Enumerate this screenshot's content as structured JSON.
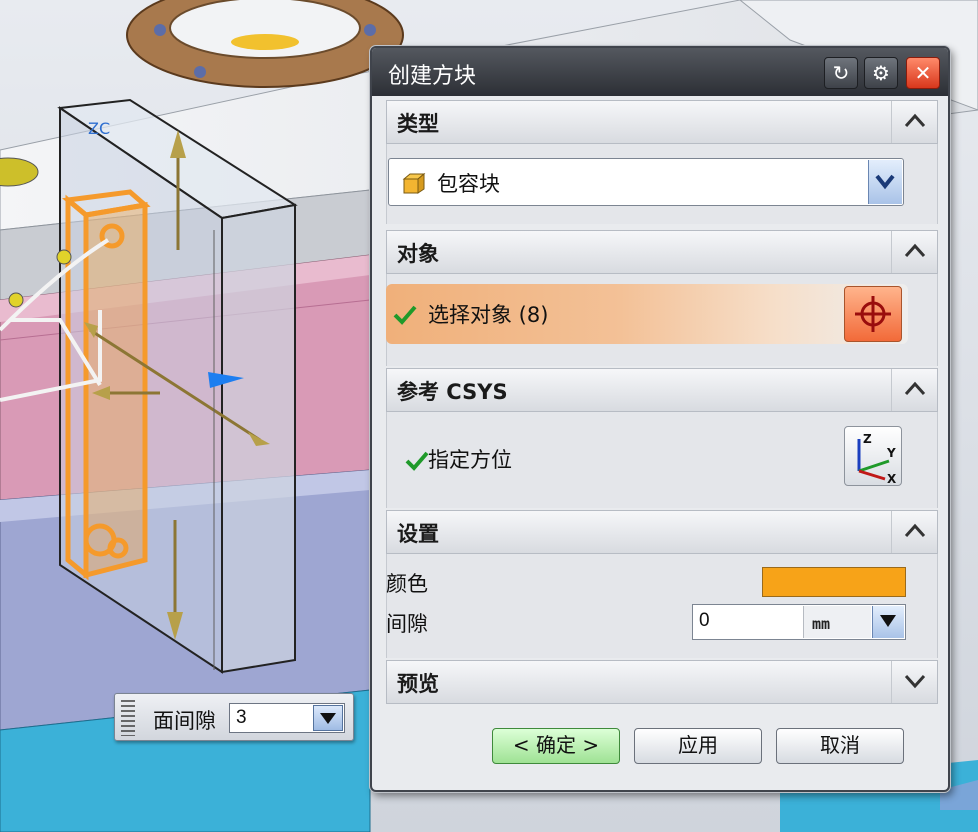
{
  "dialog": {
    "title": "创建方块",
    "buttons": {
      "reset": "↻",
      "settings": "⚙",
      "close": "✕"
    }
  },
  "sections": {
    "type": {
      "title": "类型",
      "selected": "包容块",
      "icon": "bounding-block-icon"
    },
    "object": {
      "title": "对象",
      "select_label": "选择对象 (8)",
      "status_icon": "check-icon",
      "button_icon": "crosshair-icon"
    },
    "csys": {
      "title": "参考 CSYS",
      "orient_label": "指定方位",
      "status_icon": "check-icon",
      "button_icon": "csys-axes-icon"
    },
    "settings": {
      "title": "设置",
      "color_label": "颜色",
      "color_value": "#f7a318",
      "gap_label": "间隙",
      "gap_value": "0",
      "gap_unit": "mm"
    },
    "preview": {
      "title": "预览"
    }
  },
  "actions": {
    "ok": "< 确定 >",
    "apply": "应用",
    "cancel": "取消"
  },
  "viewport": {
    "face_gap_label": "面间隙",
    "face_gap_value": "3",
    "csys_marker": "ZC"
  }
}
